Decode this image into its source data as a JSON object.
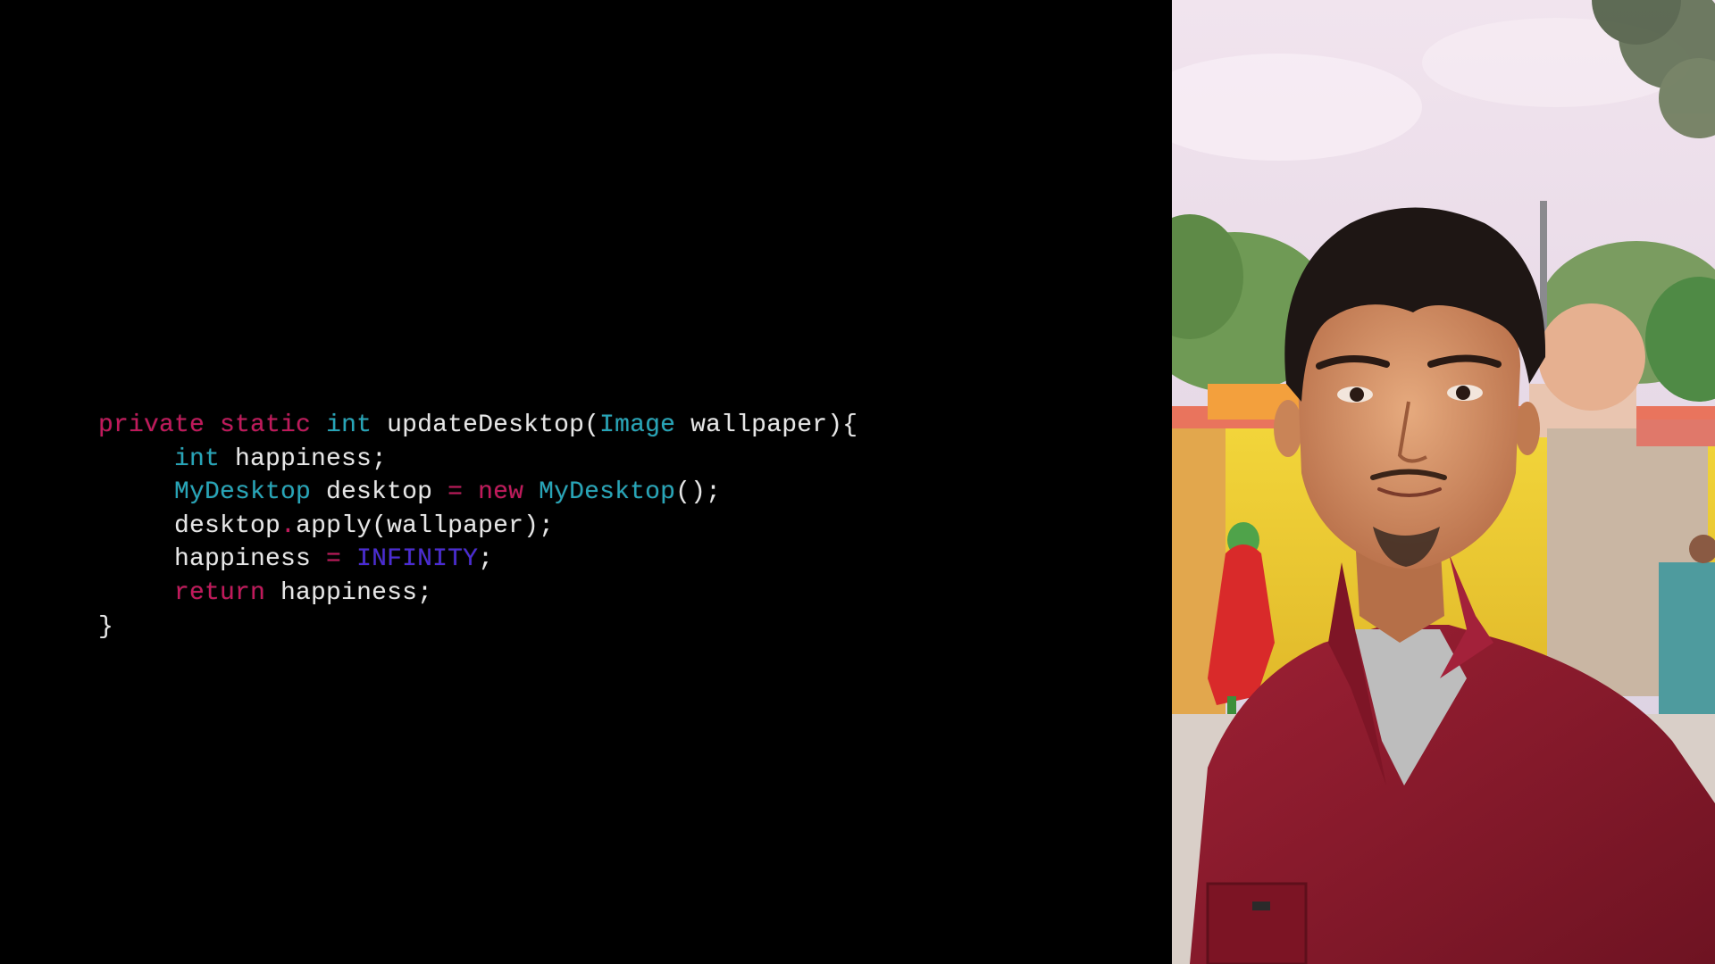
{
  "code": {
    "lines": [
      [
        {
          "t": "private",
          "c": "kw"
        },
        {
          "t": " ",
          "c": "plain"
        },
        {
          "t": "static",
          "c": "kw"
        },
        {
          "t": " ",
          "c": "plain"
        },
        {
          "t": "int",
          "c": "type"
        },
        {
          "t": " updateDesktop(",
          "c": "plain"
        },
        {
          "t": "Image",
          "c": "type"
        },
        {
          "t": " wallpaper){",
          "c": "plain"
        }
      ],
      [
        {
          "t": "     ",
          "c": "plain"
        },
        {
          "t": "int",
          "c": "type"
        },
        {
          "t": " happiness;",
          "c": "plain"
        }
      ],
      [
        {
          "t": "     ",
          "c": "plain"
        },
        {
          "t": "MyDesktop",
          "c": "type"
        },
        {
          "t": " desktop ",
          "c": "plain"
        },
        {
          "t": "=",
          "c": "op"
        },
        {
          "t": " ",
          "c": "plain"
        },
        {
          "t": "new",
          "c": "kw"
        },
        {
          "t": " ",
          "c": "plain"
        },
        {
          "t": "MyDesktop",
          "c": "type"
        },
        {
          "t": "();",
          "c": "plain"
        }
      ],
      [
        {
          "t": "     desktop",
          "c": "plain"
        },
        {
          "t": ".",
          "c": "op"
        },
        {
          "t": "apply(wallpaper);",
          "c": "plain"
        }
      ],
      [
        {
          "t": "     happiness ",
          "c": "plain"
        },
        {
          "t": "=",
          "c": "op"
        },
        {
          "t": " ",
          "c": "plain"
        },
        {
          "t": "INFINITY",
          "c": "const"
        },
        {
          "t": ";",
          "c": "plain"
        }
      ],
      [
        {
          "t": "     ",
          "c": "plain"
        },
        {
          "t": "return",
          "c": "kw"
        },
        {
          "t": " happiness;",
          "c": "plain"
        }
      ],
      [
        {
          "t": "}",
          "c": "plain"
        }
      ]
    ]
  },
  "colors": {
    "background": "#000000",
    "keyword": "#c2185b",
    "type": "#26a5b8",
    "constant": "#4a2bd6",
    "plain": "#e6e6e6",
    "shirt": "#8e1a2b"
  },
  "photo": {
    "subject": "portrait-photo"
  }
}
